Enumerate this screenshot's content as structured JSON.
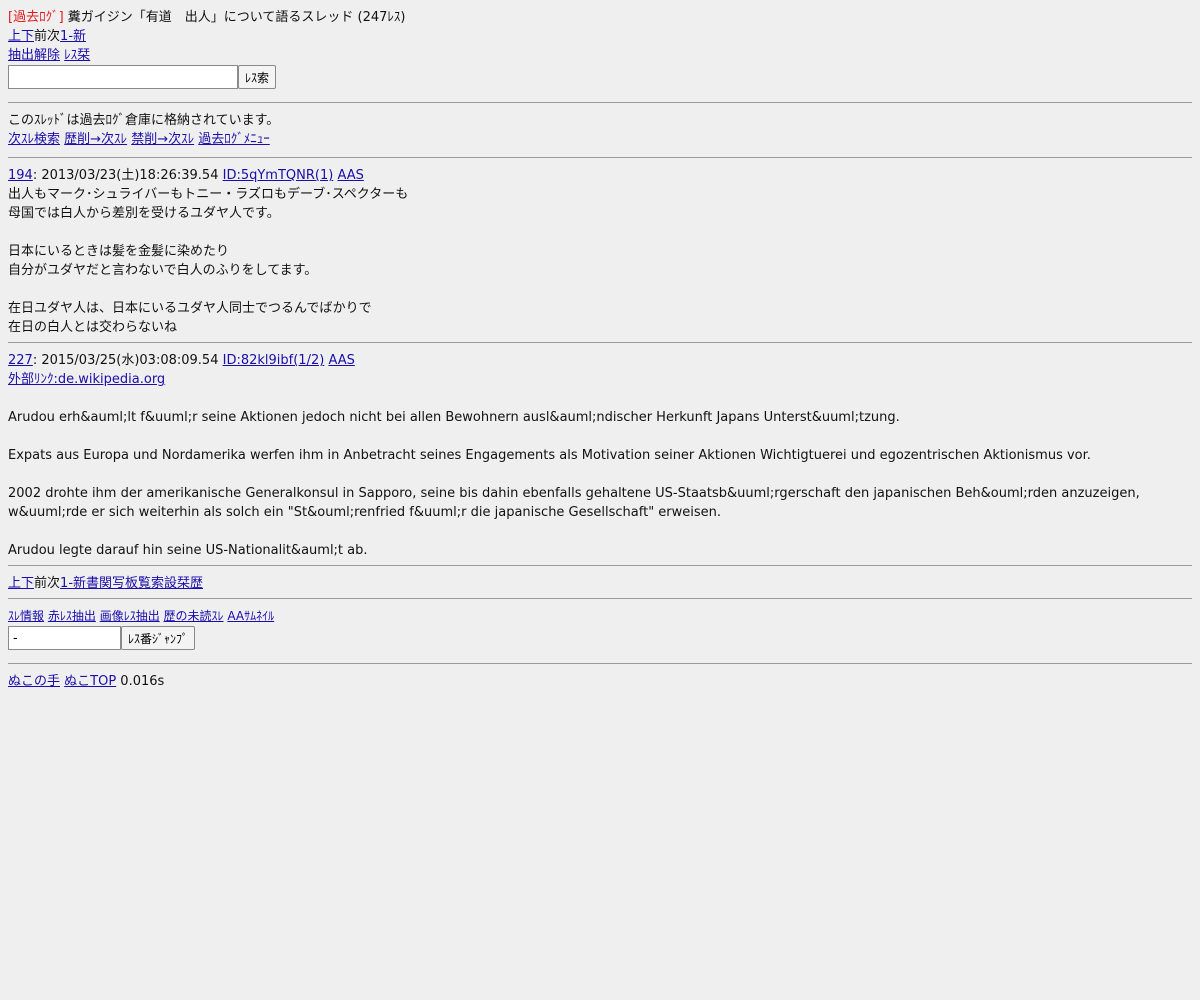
{
  "header": {
    "kako_tag": "[過去ﾛｸﾞ]",
    "title": " 糞ガイジン「有道　出人」について語るスレッド (247ﾚｽ)"
  },
  "nav_top": {
    "up": "上",
    "down": "下",
    "prev_next": "前次",
    "range": "1-新"
  },
  "filter": {
    "clear": "抽出解除",
    "res_ban": "ﾚｽ栞"
  },
  "search": {
    "value": "",
    "button": "ﾚｽ索"
  },
  "archive_notice": {
    "text": "このｽﾚｯﾄﾞは過去ﾛｸﾞ倉庫に格納されています。",
    "links": [
      "次ｽﾚ検索",
      "歴削→次ｽﾚ",
      "禁削→次ｽﾚ",
      "過去ﾛｸﾞﾒﾆｭｰ"
    ]
  },
  "posts": [
    {
      "number": "194",
      "date": ": 2013/03/23(土)18:26:39.54 ",
      "id": "ID:5qYmTQNR(1)",
      "aas": "AAS",
      "lines": [
        "出人もマーク･シュライバーもトニー・ラズロもデーブ･スペクターも",
        "母国では白人から差別を受けるユダヤ人です。",
        "",
        "日本にいるときは髪を金髪に染めたり",
        "自分がユダヤだと言わないで白人のふりをしてます。",
        "",
        "在日ユダヤ人は、日本にいるユダヤ人同士でつるんでばかりで",
        "在日の白人とは交わらないね"
      ]
    },
    {
      "number": "227",
      "date": ": 2015/03/25(水)03:08:09.54 ",
      "id": "ID:82kl9ibf(1/2)",
      "aas": "AAS",
      "link": "外部ﾘﾝｸ:de.wikipedia.org",
      "lines": [
        "",
        "Arudou erh&auml;lt f&uuml;r seine Aktionen jedoch nicht bei allen Bewohnern ausl&auml;ndischer Herkunft Japans Unterst&uuml;tzung.",
        "",
        "Expats aus Europa und Nordamerika werfen ihm in Anbetracht seines Engagements als Motivation seiner Aktionen Wichtigtuerei und egozentrischen Aktionismus vor.",
        "",
        "2002 drohte ihm der amerikanische Generalkonsul in Sapporo, seine bis dahin ebenfalls gehaltene US-Staatsb&uuml;rgerschaft den japanischen Beh&ouml;rden anzuzeigen,",
        "w&uuml;rde er sich weiterhin als solch ein \"St&ouml;renfried f&uuml;r die japanische Gesellschaft\" erweisen.",
        "",
        "Arudou legte darauf hin seine US-Nationalit&auml;t ab."
      ]
    }
  ],
  "nav_bottom": {
    "up": "上",
    "down": "下",
    "prev_next": "前次",
    "links": "1-新書関写板覧索設栞歴"
  },
  "tools": {
    "links": [
      "ｽﾚ情報",
      "赤ﾚｽ抽出",
      "画像ﾚｽ抽出",
      "歴の未読ｽﾚ",
      "AAｻﾑﾈｲﾙ"
    ]
  },
  "jump": {
    "value": "-",
    "button": "ﾚｽ番ｼﾞｬﾝﾌﾟ"
  },
  "footer": {
    "links": [
      "ぬこの手",
      "ぬこTOP"
    ],
    "time": " 0.016s"
  }
}
